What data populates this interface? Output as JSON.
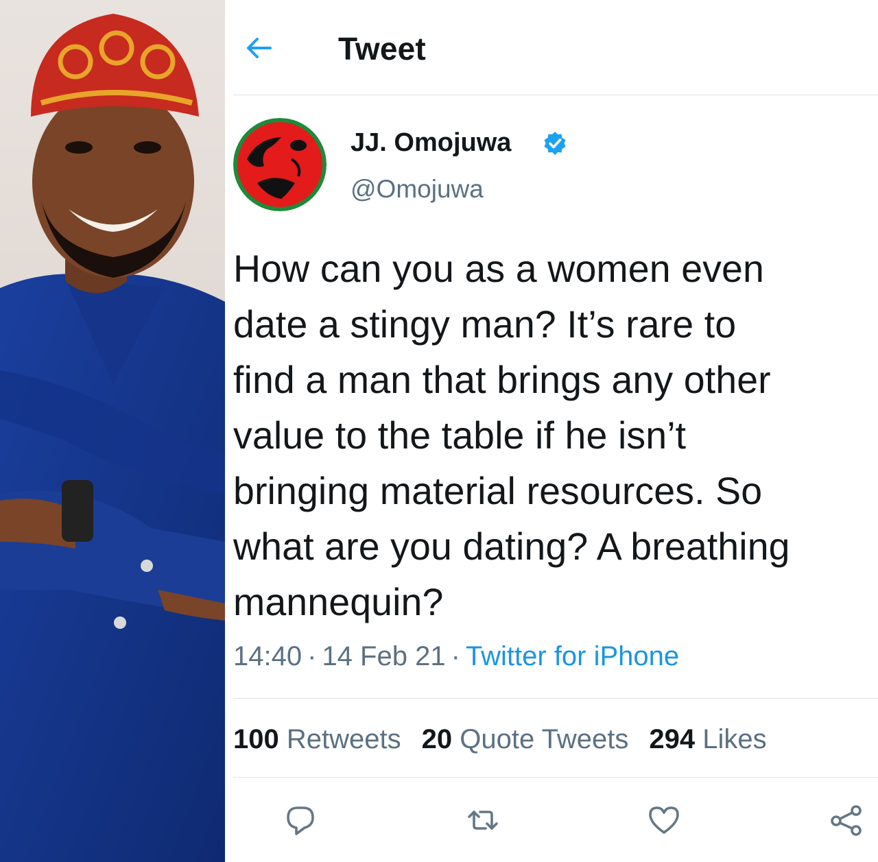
{
  "header": {
    "title": "Tweet",
    "back_icon": "arrow-left-icon"
  },
  "user": {
    "display_name": "JJ. Omojuwa",
    "handle": "@Omojuwa",
    "verified_icon": "verified-badge-icon"
  },
  "tweet": {
    "text": "How can you as a women even\ndate a stingy man? It’s rare to\nfind a man that brings any other\nvalue to the table if he isn’t\nbringing material resources. So\nwhat are you dating? A breathing\nmannequin?",
    "time": "14:40",
    "separator": "·",
    "date": "14 Feb 21",
    "source": "Twitter for iPhone"
  },
  "stats": {
    "retweets_count": "100",
    "retweets_label": "Retweets",
    "quotes_count": "20",
    "quotes_label": "Quote Tweets",
    "likes_count": "294",
    "likes_label": "Likes"
  },
  "actions": [
    "reply-icon",
    "retweet-icon",
    "like-icon",
    "share-icon"
  ],
  "colors": {
    "accent": "#1b95e0",
    "verified": "#1da1f2",
    "muted": "#5b7083",
    "text": "#14171a",
    "divider": "#dfe3e6"
  }
}
